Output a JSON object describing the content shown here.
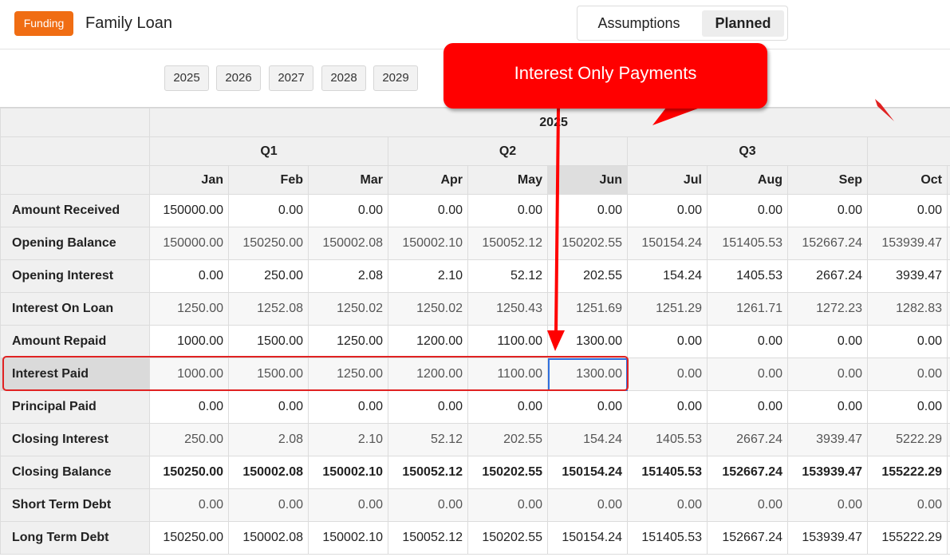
{
  "header": {
    "badge": "Funding",
    "title": "Family Loan",
    "tabs": {
      "assumptions": "Assumptions",
      "planned": "Planned"
    }
  },
  "years": [
    "2025",
    "2026",
    "2027",
    "2028",
    "2029"
  ],
  "grid": {
    "year": "2025",
    "quarters": [
      "Q1",
      "Q2",
      "Q3"
    ],
    "months": [
      "Jan",
      "Feb",
      "Mar",
      "Apr",
      "May",
      "Jun",
      "Jul",
      "Aug",
      "Sep",
      "Oct"
    ],
    "rows": [
      {
        "label": "Amount Received",
        "values": [
          "150000.00",
          "0.00",
          "0.00",
          "0.00",
          "0.00",
          "0.00",
          "0.00",
          "0.00",
          "0.00",
          "0.00"
        ]
      },
      {
        "label": "Opening Balance",
        "values": [
          "150000.00",
          "150250.00",
          "150002.08",
          "150002.10",
          "150052.12",
          "150202.55",
          "150154.24",
          "151405.53",
          "152667.24",
          "153939.47"
        ]
      },
      {
        "label": "Opening Interest",
        "values": [
          "0.00",
          "250.00",
          "2.08",
          "2.10",
          "52.12",
          "202.55",
          "154.24",
          "1405.53",
          "2667.24",
          "3939.47"
        ]
      },
      {
        "label": "Interest On Loan",
        "values": [
          "1250.00",
          "1252.08",
          "1250.02",
          "1250.02",
          "1250.43",
          "1251.69",
          "1251.29",
          "1261.71",
          "1272.23",
          "1282.83"
        ]
      },
      {
        "label": "Amount Repaid",
        "values": [
          "1000.00",
          "1500.00",
          "1250.00",
          "1200.00",
          "1100.00",
          "1300.00",
          "0.00",
          "0.00",
          "0.00",
          "0.00"
        ]
      },
      {
        "label": "Interest Paid",
        "values": [
          "1000.00",
          "1500.00",
          "1250.00",
          "1200.00",
          "1100.00",
          "1300.00",
          "0.00",
          "0.00",
          "0.00",
          "0.00"
        ]
      },
      {
        "label": "Principal Paid",
        "values": [
          "0.00",
          "0.00",
          "0.00",
          "0.00",
          "0.00",
          "0.00",
          "0.00",
          "0.00",
          "0.00",
          "0.00"
        ]
      },
      {
        "label": "Closing Interest",
        "values": [
          "250.00",
          "2.08",
          "2.10",
          "52.12",
          "202.55",
          "154.24",
          "1405.53",
          "2667.24",
          "3939.47",
          "5222.29"
        ]
      },
      {
        "label": "Closing Balance",
        "values": [
          "150250.00",
          "150002.08",
          "150002.10",
          "150052.12",
          "150202.55",
          "150154.24",
          "151405.53",
          "152667.24",
          "153939.47",
          "155222.29"
        ]
      },
      {
        "label": "Short Term Debt",
        "values": [
          "0.00",
          "0.00",
          "0.00",
          "0.00",
          "0.00",
          "0.00",
          "0.00",
          "0.00",
          "0.00",
          "0.00"
        ]
      },
      {
        "label": "Long Term Debt",
        "values": [
          "150250.00",
          "150002.08",
          "150002.10",
          "150052.12",
          "150202.55",
          "150154.24",
          "151405.53",
          "152667.24",
          "153939.47",
          "155222.29"
        ]
      }
    ]
  },
  "annotation": {
    "callout": "Interest Only Payments",
    "color": "#ff0000"
  }
}
